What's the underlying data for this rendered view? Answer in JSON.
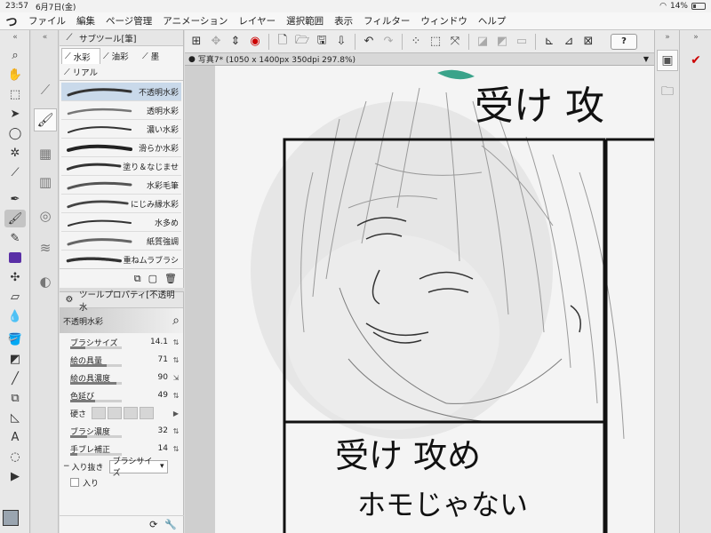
{
  "status_bar": {
    "time": "23:57",
    "date": "6月7日(金)",
    "battery": "14%"
  },
  "menu": {
    "logo": "つ",
    "items": [
      "ファイル",
      "編集",
      "ページ管理",
      "アニメーション",
      "レイヤー",
      "選択範囲",
      "表示",
      "フィルター",
      "ウィンドウ",
      "ヘルプ"
    ]
  },
  "toolbar": {
    "help_label": "?"
  },
  "document": {
    "title": "写真7* (1050 x 1400px 350dpi 297.8%)"
  },
  "subtool_panel": {
    "title": "サブツール[筆]",
    "tabs": [
      "水彩",
      "油彩",
      "墨",
      "リアル"
    ],
    "brushes": [
      "不透明水彩",
      "透明水彩",
      "濃い水彩",
      "滑らか水彩",
      "塗り＆なじませ",
      "水彩毛筆",
      "にじみ縁水彩",
      "水多め",
      "紙質強調",
      "重ねムラブラシ"
    ],
    "selected_index": 0
  },
  "tool_property": {
    "title": "ツールプロパティ[不透明水",
    "brush_name": "不透明水彩",
    "rows": [
      {
        "label": "ブラシサイズ",
        "value": "14.1",
        "level": 0.3
      },
      {
        "label": "絵の具量",
        "value": "71",
        "level": 0.71
      },
      {
        "label": "絵の具濃度",
        "value": "90",
        "level": 0.9
      },
      {
        "label": "色延び",
        "value": "49",
        "level": 0.49
      }
    ],
    "hardness_label": "硬さ",
    "rows2": [
      {
        "label": "ブラシ濃度",
        "value": "32",
        "level": 0.32
      },
      {
        "label": "手ブレ補正",
        "value": "14",
        "level": 0.14
      }
    ],
    "entry_exit_label": "入り抜き",
    "entry_exit_select": "ブラシサイズ",
    "entry_label": "入り"
  },
  "canvas": {
    "panel1_text": "受け 攻",
    "panel2_text_top": "受け 攻め",
    "panel2_text_bottom": "ホモじゃない"
  }
}
